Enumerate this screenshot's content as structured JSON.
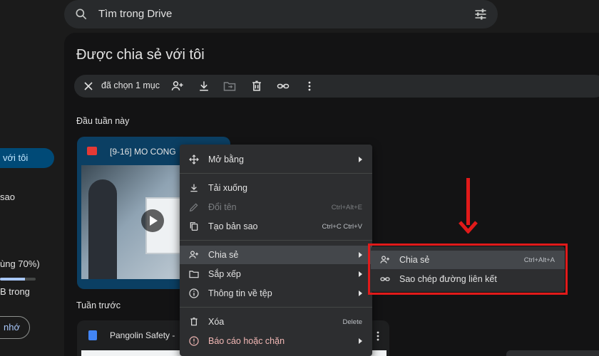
{
  "search": {
    "placeholder": "Tìm trong Drive"
  },
  "sidebar": {
    "active_item": "với tôi",
    "item_fragment": "sao",
    "storage_text": "ùng 70%)",
    "storage_sub": "B trong",
    "storage_fraction": 0.7,
    "button_label": "nhớ"
  },
  "page": {
    "title": "Được chia sẻ với tôi"
  },
  "actionbar": {
    "selected_label": "đã chọn 1 mục",
    "icons": [
      "share-person-icon",
      "download-icon",
      "move-folder-icon",
      "delete-icon",
      "link-icon",
      "more-vert-icon"
    ]
  },
  "sections": {
    "this_week": "Đầu tuần này",
    "last_week": "Tuần trước"
  },
  "files": {
    "video": {
      "title": "[9-16] MO CONG"
    },
    "doc": {
      "title": "Pangolin Safety -"
    }
  },
  "context_menu": {
    "items": [
      {
        "label": "Mở bằng",
        "icon": "open-with-icon",
        "submenu": true
      },
      {
        "label": "Tải xuống",
        "icon": "download-icon"
      },
      {
        "label": "Đổi tên",
        "icon": "rename-icon",
        "shortcut": "Ctrl+Alt+E",
        "disabled": true
      },
      {
        "label": "Tạo bản sao",
        "icon": "copy-icon",
        "shortcut": "Ctrl+C Ctrl+V"
      },
      {
        "label": "Chia sẻ",
        "icon": "share-person-icon",
        "submenu": true,
        "highlighted": true
      },
      {
        "label": "Sắp xếp",
        "icon": "folder-icon",
        "submenu": true
      },
      {
        "label": "Thông tin về tệp",
        "icon": "info-icon",
        "submenu": true
      },
      {
        "label": "Xóa",
        "icon": "delete-icon",
        "shortcut": "Delete"
      },
      {
        "label": "Báo cáo hoặc chặn",
        "icon": "report-icon",
        "submenu": true
      }
    ]
  },
  "share_submenu": {
    "items": [
      {
        "label": "Chia sẻ",
        "icon": "share-person-icon",
        "shortcut": "Ctrl+Alt+A",
        "highlighted": true
      },
      {
        "label": "Sao chép đường liên kết",
        "icon": "link-icon"
      }
    ]
  },
  "colors": {
    "highlight_box": "#e11a1a",
    "active_nav": "#004a77",
    "warning_text": "#f2b8b5"
  }
}
